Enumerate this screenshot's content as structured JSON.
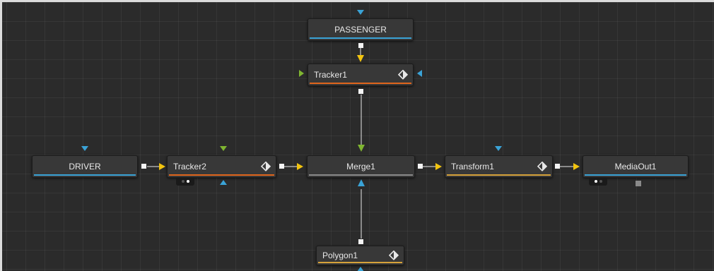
{
  "nodes": {
    "passenger": {
      "label": "PASSENGER"
    },
    "tracker1": {
      "label": "Tracker1"
    },
    "driver": {
      "label": "DRIVER"
    },
    "tracker2": {
      "label": "Tracker2"
    },
    "merge1": {
      "label": "Merge1"
    },
    "transform1": {
      "label": "Transform1"
    },
    "mediaout1": {
      "label": "MediaOut1"
    },
    "polygon1": {
      "label": "Polygon1"
    }
  },
  "colors": {
    "canvas_bg": "#2b2b2b",
    "node_bg": "#383838",
    "loader_stripe": "#3aa3d7",
    "tracker_stripe": "#e0651c",
    "merge_stripe": "#8a8a8a",
    "transform_stripe": "#d6a23a",
    "polygon_stripe": "#d6a23a",
    "mediaout_stripe": "#3aa3d7",
    "arrow_yellow": "#f2c40f",
    "input_blue": "#3aa3d7",
    "input_green": "#7fb531"
  },
  "icons": {
    "keyframe": "keyframe-diamond-icon",
    "view_toggle": "view-toggle-icon"
  }
}
